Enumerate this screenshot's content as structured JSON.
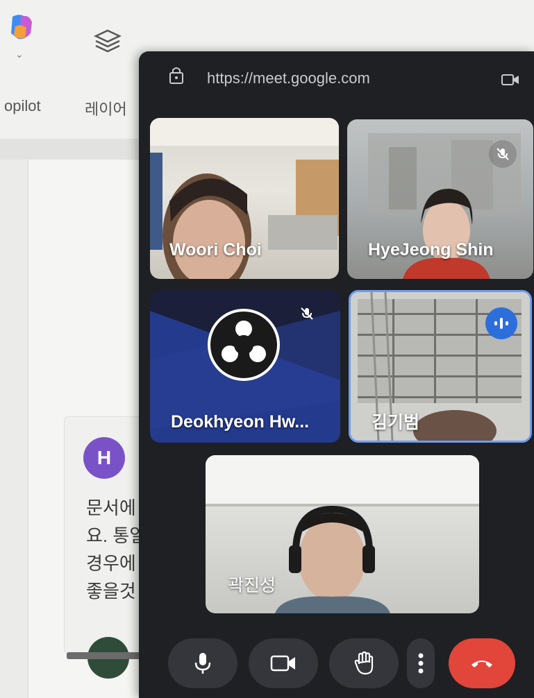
{
  "background_app": {
    "toolbar": {
      "copilot_label": "opilot",
      "layers_label": "레이어"
    },
    "comment": {
      "avatar_letter": "H",
      "lines": [
        "문서에",
        "요. 통일",
        "경우에",
        "좋을것"
      ]
    }
  },
  "meet": {
    "url": "https://meet.google.com",
    "participants": [
      {
        "name": "Woori Choi",
        "muted": false,
        "speaking": false
      },
      {
        "name": "HyeJeong Shin",
        "muted": true,
        "speaking": false
      },
      {
        "name": "Deokhyeon Hw...",
        "muted": true,
        "speaking": false
      },
      {
        "name": "김기범",
        "muted": false,
        "speaking": true
      },
      {
        "name": "곽진성",
        "muted": false,
        "speaking": false
      }
    ],
    "controls": [
      "microphone",
      "camera",
      "raise-hand",
      "more-options",
      "leave-call"
    ]
  },
  "colors": {
    "meet_bg": "#1f2023",
    "control_bg": "#34363b",
    "end_call": "#e2453a",
    "speaking_border": "#6e9df0",
    "speaking_badge": "#2c6fdb",
    "avatar_h": "#7a52c8"
  }
}
